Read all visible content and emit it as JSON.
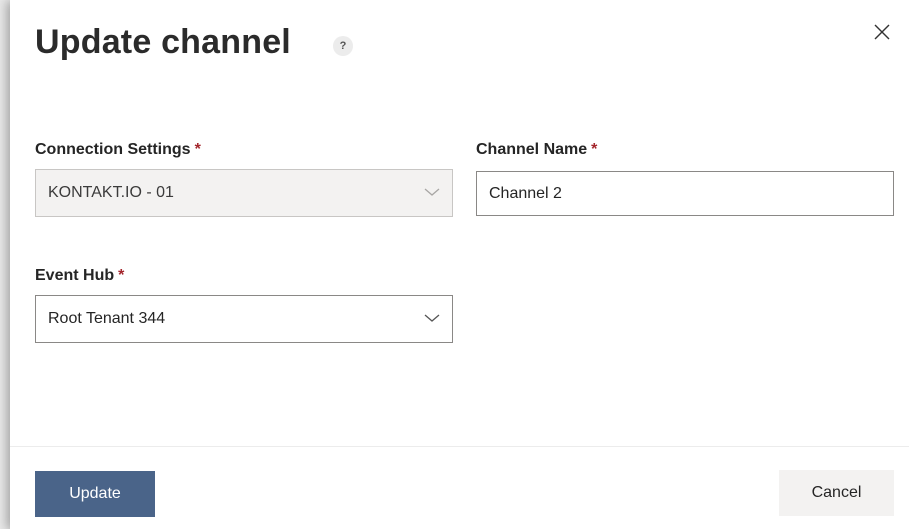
{
  "dialog": {
    "title": "Update channel",
    "help_icon": "?"
  },
  "form": {
    "connection_settings": {
      "label": "Connection Settings",
      "required_marker": "*",
      "value": "KONTAKT.IO - 01",
      "disabled": true
    },
    "channel_name": {
      "label": "Channel Name",
      "required_marker": "*",
      "value": "Channel 2"
    },
    "event_hub": {
      "label": "Event Hub",
      "required_marker": "*",
      "value": "Root Tenant 344"
    }
  },
  "footer": {
    "update_label": "Update",
    "cancel_label": "Cancel"
  },
  "colors": {
    "primary_button": "#4a6489",
    "required_marker": "#a4262c",
    "disabled_field_bg": "#f3f2f1"
  },
  "icons": [
    "help-icon",
    "close-icon",
    "chevron-down-icon"
  ]
}
